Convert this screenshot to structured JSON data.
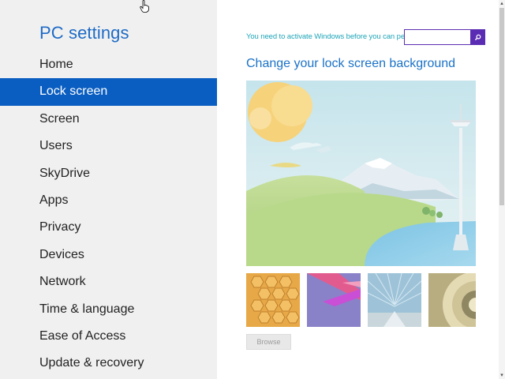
{
  "nav": {
    "title": "PC settings",
    "items": [
      {
        "label": "Home"
      },
      {
        "label": "Lock screen"
      },
      {
        "label": "Screen"
      },
      {
        "label": "Users"
      },
      {
        "label": "SkyDrive"
      },
      {
        "label": "Apps"
      },
      {
        "label": "Privacy"
      },
      {
        "label": "Devices"
      },
      {
        "label": "Network"
      },
      {
        "label": "Time & language"
      },
      {
        "label": "Ease of Access"
      },
      {
        "label": "Update & recovery"
      }
    ],
    "selected_index": 1
  },
  "content": {
    "activation_message": "You need to activate Windows before you can personalize your PC.",
    "search": {
      "value": "",
      "icon": "search-icon"
    },
    "heading": "Change your lock screen background",
    "thumbnails": [
      {
        "name": "honeycomb"
      },
      {
        "name": "purple-ribbons"
      },
      {
        "name": "glass-ceiling"
      },
      {
        "name": "shell-spiral"
      }
    ],
    "browse_label": "Browse"
  },
  "colors": {
    "accent": "#0a5ec1",
    "title": "#1e6bc6",
    "notice": "#1fa5b8",
    "search": "#5a2bb3"
  }
}
